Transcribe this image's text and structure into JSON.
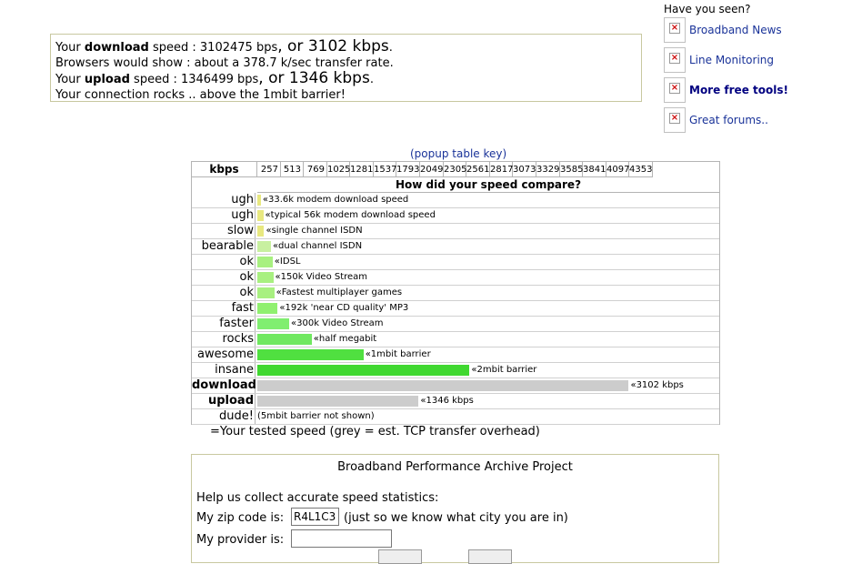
{
  "result": {
    "line1": {
      "a": "Your ",
      "b": "download",
      "c": " speed : 3102475 bps",
      "d": ", or 3102 kbps",
      "e": "."
    },
    "line2": "Browsers would show : about a 378.7 k/sec transfer rate.",
    "line3": {
      "a": "Your ",
      "b": "upload",
      "c": " speed : 1346499 bps",
      "d": ", or 1346 kbps",
      "e": "."
    },
    "line4": "Your connection rocks .. above the 1mbit barrier!"
  },
  "sidebar": {
    "heading": "Have you seen?",
    "items": [
      {
        "label": "Broadband News",
        "bold": false
      },
      {
        "label": "Line Monitoring",
        "bold": false
      },
      {
        "label": "More free tools!",
        "bold": true
      },
      {
        "label": "Great forums..",
        "bold": false
      }
    ]
  },
  "popup_key": "(popup table key)",
  "chart_data": {
    "type": "bar",
    "header": "kbps",
    "title": "How did your speed compare?",
    "ticks": [
      "257",
      "513",
      "769",
      "1025",
      "1281",
      "1537",
      "1793",
      "2049",
      "2305",
      "2561",
      "2817",
      "3073",
      "3329",
      "3585",
      "3841",
      "4097",
      "4353"
    ],
    "xlim": [
      0,
      4353
    ],
    "rows": [
      {
        "label": "ugh",
        "value": 33.6,
        "overhead": 0,
        "color": "#e8e880",
        "note": "«33.6k modem download speed",
        "bold": false
      },
      {
        "label": "ugh",
        "value": 56,
        "overhead": 0,
        "color": "#e8e880",
        "note": "«typical 56k modem download speed",
        "bold": false
      },
      {
        "label": "slow",
        "value": 64,
        "overhead": 0,
        "color": "#e8e880",
        "note": "«single channel ISDN",
        "bold": false
      },
      {
        "label": "bearable",
        "value": 128,
        "overhead": 0,
        "color": "#c8f0a0",
        "note": "«dual channel ISDN",
        "bold": false
      },
      {
        "label": "ok",
        "value": 144,
        "overhead": 0,
        "color": "#a8f080",
        "note": "«IDSL",
        "bold": false
      },
      {
        "label": "ok",
        "value": 150,
        "overhead": 0,
        "color": "#a8f080",
        "note": "«150k Video Stream",
        "bold": false
      },
      {
        "label": "ok",
        "value": 160,
        "overhead": 0,
        "color": "#a8f080",
        "note": "«Fastest multiplayer games",
        "bold": false
      },
      {
        "label": "fast",
        "value": 192,
        "overhead": 0,
        "color": "#90f070",
        "note": "«192k 'near CD quality' MP3",
        "bold": false
      },
      {
        "label": "faster",
        "value": 300,
        "overhead": 0,
        "color": "#80ee70",
        "note": "«300k Video Stream",
        "bold": false
      },
      {
        "label": "rocks",
        "value": 512,
        "overhead": 0,
        "color": "#70e860",
        "note": "«half megabit",
        "bold": false
      },
      {
        "label": "awesome",
        "value": 1000,
        "overhead": 110,
        "color": "#50e040",
        "note": "«1mbit barrier",
        "bold": false
      },
      {
        "label": "insane",
        "value": 2000,
        "overhead": 250,
        "color": "#40d830",
        "note": "«2mbit barrier",
        "bold": false
      },
      {
        "label": "download",
        "value": 0,
        "overhead": 3500,
        "color": "#cccccc",
        "note": "«3102 kbps",
        "bold": true
      },
      {
        "label": "upload",
        "value": 0,
        "overhead": 1520,
        "color": "#cccccc",
        "note": "«1346 kbps",
        "bold": true
      },
      {
        "label": "dude!",
        "value": 0,
        "overhead": 0,
        "color": "#cccccc",
        "note": "(5mbit barrier not shown)",
        "bold": false
      }
    ],
    "overhead_color": "#cccccc"
  },
  "legend_text": "=Your tested speed (grey = est. TCP transfer overhead)",
  "archive": {
    "title": "Broadband Performance Archive Project",
    "help": "Help us collect accurate speed statistics:",
    "zip_label": "My zip code is:",
    "zip_value": "R4L1C3",
    "zip_note": "(just so we know what city you are in)",
    "provider_label": "My provider is:",
    "provider_value": ""
  }
}
